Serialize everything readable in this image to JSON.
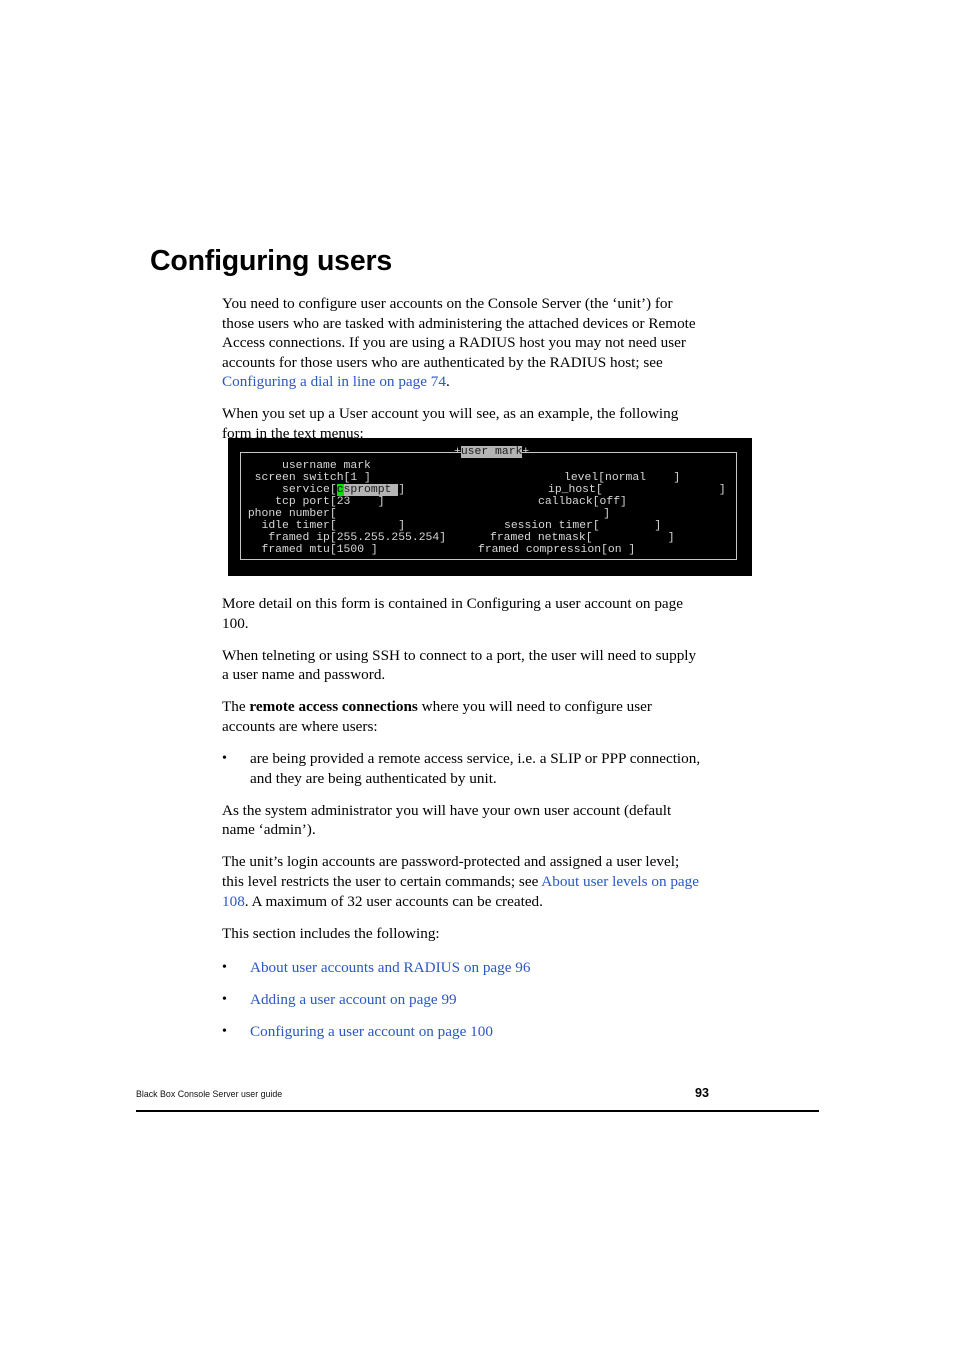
{
  "document": {
    "heading": "Configuring users",
    "footer_text": "Black Box Console Server user guide",
    "page_number": "93",
    "link_color": "#2b57c4"
  },
  "paragraphs": {
    "p1_part1": "You need to configure user accounts on the Console Server (the ‘unit’) for those users who are tasked with administering the attached devices or Remote Access connections. If you are using a RADIUS host you may not need user accounts for those users who are authenticated by the RADIUS host; see ",
    "p1_link": "Configuring a dial in line on page 74",
    "p1_part2": ".",
    "p2": "When you set up a User account you will see, as an example, the following form in the text menus:",
    "p3": "More detail on this form is contained in Configuring a user account on page 100.",
    "p4": "When telneting or using SSH to connect to a port, the user will need to supply a user name and password.",
    "p5_part1": "The ",
    "p5_bold": "remote access connections",
    "p5_part2": " where you will need to configure user accounts are where users:",
    "p6": "As the system administrator you will have your own user account (default name ‘admin’).",
    "p7_part1": "The unit’s login accounts are password-protected and assigned a user level; this level restricts the user to certain commands; see ",
    "p7_link": "About user levels on page 108",
    "p7_part2": ". A maximum of 32 user accounts can be created.",
    "p8": "This section includes the following:"
  },
  "bullets": {
    "marker": "•",
    "item1": "are being provided a remote access service, i.e. a SLIP or PPP connection, and they are being authenticated by unit."
  },
  "section_links": {
    "marker": "•",
    "link1": "About user accounts and RADIUS on page 96",
    "link2": "Adding a user account on page 99",
    "link3": "Configuring a user account on page 100"
  },
  "terminal": {
    "title_plus_left": "+",
    "title": "user mark",
    "title_plus_right": "+",
    "lines": {
      "l1_left": "      username mark",
      "l2_left": "  screen switch[1 ]",
      "l2_right": "level[normal    ]",
      "l3_left_pre": "      service[",
      "l3_cursor": "c",
      "l3_field": "sprompt ",
      "l3_left_post": "]",
      "l3_right": "ip_host[                 ]",
      "l4_left": "     tcp port[23    ]",
      "l4_right": "callback[off]",
      "l5_left": " phone number[                                       ]",
      "l6_left": "   idle timer[         ]",
      "l6_right": "session timer[        ]",
      "l7_left": "    framed ip[255.255.255.254]",
      "l7_right": "framed netmask[           ]",
      "l8_left": "   framed mtu[1500 ]",
      "l8_right": "framed compression[on ]"
    },
    "bg_color": "#000000",
    "text_color": "#d8d8d8",
    "highlight_color": "#b4b4b4",
    "cursor_color": "#00e000"
  }
}
